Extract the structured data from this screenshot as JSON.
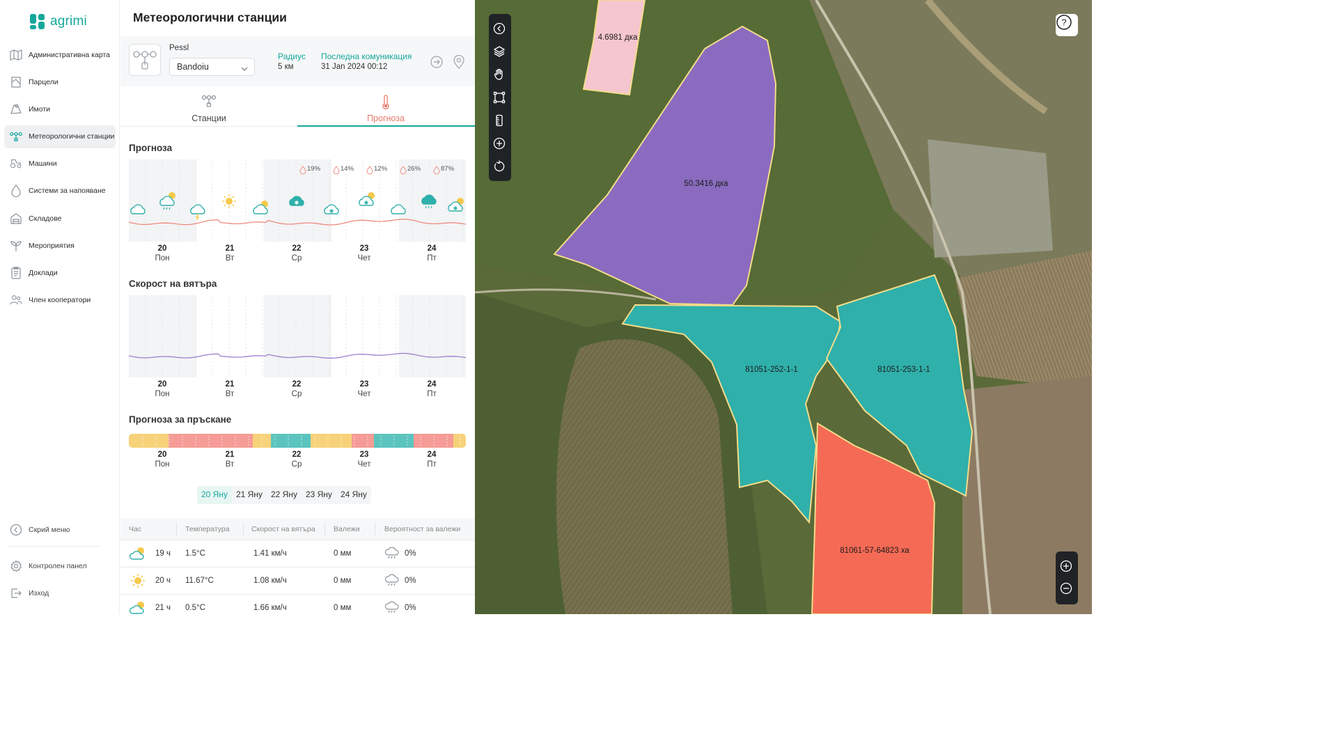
{
  "app": {
    "logo_text": "agrimi",
    "brand_color": "#16a79a"
  },
  "sidebar": {
    "items": [
      {
        "label": "Административна карта",
        "icon": "map-icon"
      },
      {
        "label": "Парцели",
        "icon": "parcel-icon"
      },
      {
        "label": "Имоти",
        "icon": "property-icon"
      },
      {
        "label": "Метеорологични станции",
        "icon": "weather-station-icon",
        "active": true
      },
      {
        "label": "Машини",
        "icon": "tractor-icon"
      },
      {
        "label": "Системи за напояване",
        "icon": "water-drop-icon"
      },
      {
        "label": "Складове",
        "icon": "warehouse-icon"
      },
      {
        "label": "Мероприятия",
        "icon": "plant-icon"
      },
      {
        "label": "Доклади",
        "icon": "report-icon"
      },
      {
        "label": "Член кооператори",
        "icon": "members-icon"
      }
    ],
    "hide_menu": "Скрий меню",
    "control_panel": "Контролен панел",
    "logout": "Изход"
  },
  "panel": {
    "title": "Метеорологични станции",
    "station": {
      "provider": "Pessl",
      "selected": "Bandoiu",
      "radius_label": "Радиус",
      "radius_value": "5 км",
      "last_comm_label": "Последна комуникация",
      "last_comm_value": "31 Jan 2024 00:12"
    },
    "tabs": [
      {
        "label": "Станции"
      },
      {
        "label": "Прогноза",
        "active": true
      }
    ],
    "forecast_title": "Прогноза",
    "wind_title": "Скорост на вятъра",
    "spray_title": "Прогноза за пръскане",
    "days": [
      {
        "num": "20",
        "name": "Пон"
      },
      {
        "num": "21",
        "name": "Вт"
      },
      {
        "num": "22",
        "name": "Ср"
      },
      {
        "num": "23",
        "name": "Чет"
      },
      {
        "num": "24",
        "name": "Пт"
      }
    ],
    "precip_badges": [
      "19%",
      "14%",
      "12%",
      "26%",
      "87%"
    ],
    "weather_icons": [
      "cloud",
      "cloud-rain-sun",
      "cloud-storm",
      "sun",
      "cloud-sun",
      "cloud-snow-dark",
      "cloud-snow",
      "cloud-snow-sun",
      "cloud",
      "cloud-rain-dark",
      "cloud-snow-sun"
    ],
    "day_tabs": [
      "20 Яну",
      "21 Яну",
      "22 Яну",
      "23 Яну",
      "24 Яну"
    ],
    "table": {
      "headers": [
        "Час",
        "Температура",
        "Скорост на вятъра",
        "Валежи",
        "Вероятност за валежи"
      ],
      "rows": [
        {
          "hour": "19 ч",
          "temp": "1.5°C",
          "wind": "1.41 км/ч",
          "precip": "0 мм",
          "prob": "0%",
          "icon": "cloud-sun-icon"
        },
        {
          "hour": "20 ч",
          "temp": "11.67°C",
          "wind": "1.08 км/ч",
          "precip": "0 мм",
          "prob": "0%",
          "icon": "sun-icon"
        },
        {
          "hour": "21 ч",
          "temp": "0.5°C",
          "wind": "1.66 км/ч",
          "precip": "0 мм",
          "prob": "0%",
          "icon": "cloud-sun-icon"
        }
      ]
    }
  },
  "map": {
    "parcels": [
      {
        "label": "4.6981 дка",
        "color": "#f5c6cf"
      },
      {
        "label": "50.3416 дка",
        "color": "#8a6bbf"
      },
      {
        "label": "81051-252-1-1",
        "color": "#2fb0aa"
      },
      {
        "label": "81051-253-1-1",
        "color": "#2fb0aa"
      },
      {
        "label": "81061-57-64823 ха",
        "color": "#f56a55"
      }
    ],
    "help": "?"
  },
  "colors": {
    "temp_line": "#ee8a7e",
    "wind_line": "#9b7fd0",
    "spray_yellow": "#f7d27a",
    "spray_red": "#f59c96",
    "spray_teal": "#5cc4be"
  }
}
